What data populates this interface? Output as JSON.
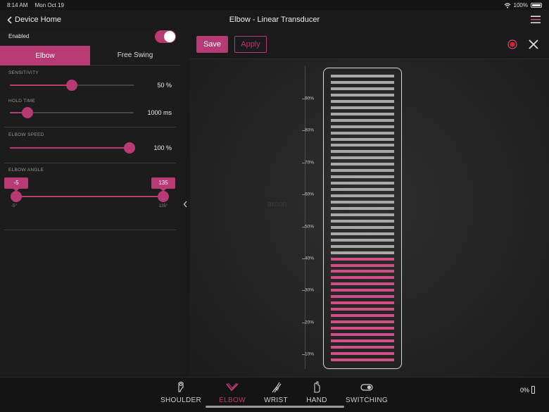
{
  "status": {
    "time": "8:14 AM",
    "date": "Mon Oct 19",
    "battery": "100%"
  },
  "nav": {
    "back_label": "Device Home",
    "title": "Elbow - Linear Transducer"
  },
  "sidebar": {
    "enabled_label": "Enabled",
    "enabled_on": true,
    "tabs": [
      "Elbow",
      "Free Swing"
    ],
    "sensitivity": {
      "label": "SENSITIVITY",
      "value": "50 %",
      "fraction": 0.5
    },
    "hold_time": {
      "label": "HOLD TIME",
      "value": "1000 ms",
      "fraction": 0.14
    },
    "elbow_speed": {
      "label": "ELBOW SPEED",
      "value": "100 %",
      "fraction": 1.0
    },
    "elbow_angle": {
      "label": "ELBOW ANGLE",
      "min": "-5",
      "max": "135",
      "min_tick": "-5°",
      "max_tick": "135°"
    }
  },
  "toolbar": {
    "save_label": "Save",
    "apply_label": "Apply"
  },
  "watermark": "arcon",
  "gauge": {
    "ticks": [
      "90%",
      "80%",
      "70%",
      "60%",
      "50%",
      "40%",
      "30%",
      "20%",
      "10%"
    ],
    "level_percent": 38,
    "bar_count": 46,
    "active_color": "#d04f86",
    "inactive_color": "#a8a8a8"
  },
  "tabbar": {
    "tabs": [
      "SHOULDER",
      "ELBOW",
      "WRIST",
      "HAND",
      "SWITCHING"
    ],
    "active": "ELBOW",
    "battery": "0%"
  },
  "colors": {
    "accent": "#b83a72"
  }
}
